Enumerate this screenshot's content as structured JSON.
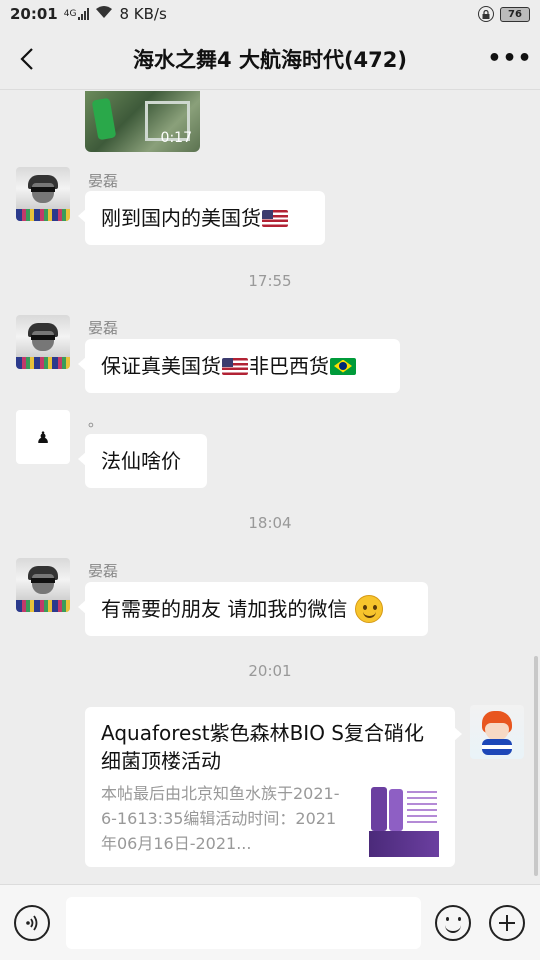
{
  "status_bar": {
    "time": "20:01",
    "network": "4G",
    "speed": "8 KB/s",
    "battery": "76"
  },
  "header": {
    "title": "海水之舞4 大航海时代(472)",
    "more": "•••"
  },
  "messages": {
    "video_duration": "0:17",
    "m1_sender": "晏磊",
    "m1_text": "刚到国内的美国货",
    "time1": "17:55",
    "m2_sender": "晏磊",
    "m2_text_a": "保证真美国货",
    "m2_text_b": "非巴西货",
    "m3_sender": "。",
    "m3_avatar_glyph": "♟",
    "m3_text": "法仙啥价",
    "time2": "18:04",
    "m4_sender": "晏磊",
    "m4_text": "有需要的朋友 请加我的微信",
    "time3": "20:01"
  },
  "link_card": {
    "title": "Aquaforest紫色森林BIO S复合硝化细菌顶楼活动",
    "description": "本帖最后由北京知鱼水族于2021-6-1613:35编辑活动时间：2021年06月16日-2021..."
  },
  "input": {
    "placeholder": ""
  },
  "colors": {
    "background": "#ededed",
    "bubble": "#ffffff"
  }
}
